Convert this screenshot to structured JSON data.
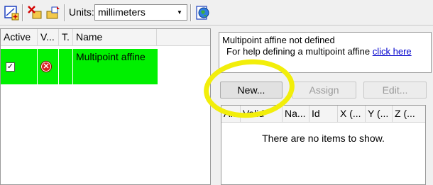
{
  "toolbar": {
    "buttons": [
      {
        "name": "add-transform-icon"
      },
      {
        "name": "delete-transform-icon"
      },
      {
        "name": "import-transform-icon"
      },
      {
        "name": "georeference-icon"
      }
    ],
    "units_label": "Units:",
    "units_value": "millimeters"
  },
  "left_list": {
    "columns": [
      "Active",
      "V...",
      "T.",
      "Name"
    ],
    "rows": [
      {
        "active": true,
        "valid_icon": "invalid-icon",
        "name": "Multipoint affine"
      }
    ],
    "row_color": "#00f000"
  },
  "info": {
    "line1": "Multipoint affine not defined",
    "line2": "For help defining a multipoint affine",
    "link": "click here"
  },
  "buttons": {
    "new": "New...",
    "assign": "Assign",
    "edit": "Edit..."
  },
  "right_list": {
    "columns": [
      "A...",
      "Valid",
      "Na...",
      "Id",
      "X (...",
      "Y (...",
      "Z (..."
    ],
    "empty_message": "There are no items to show."
  },
  "annotation_color": "#f2ee0a"
}
